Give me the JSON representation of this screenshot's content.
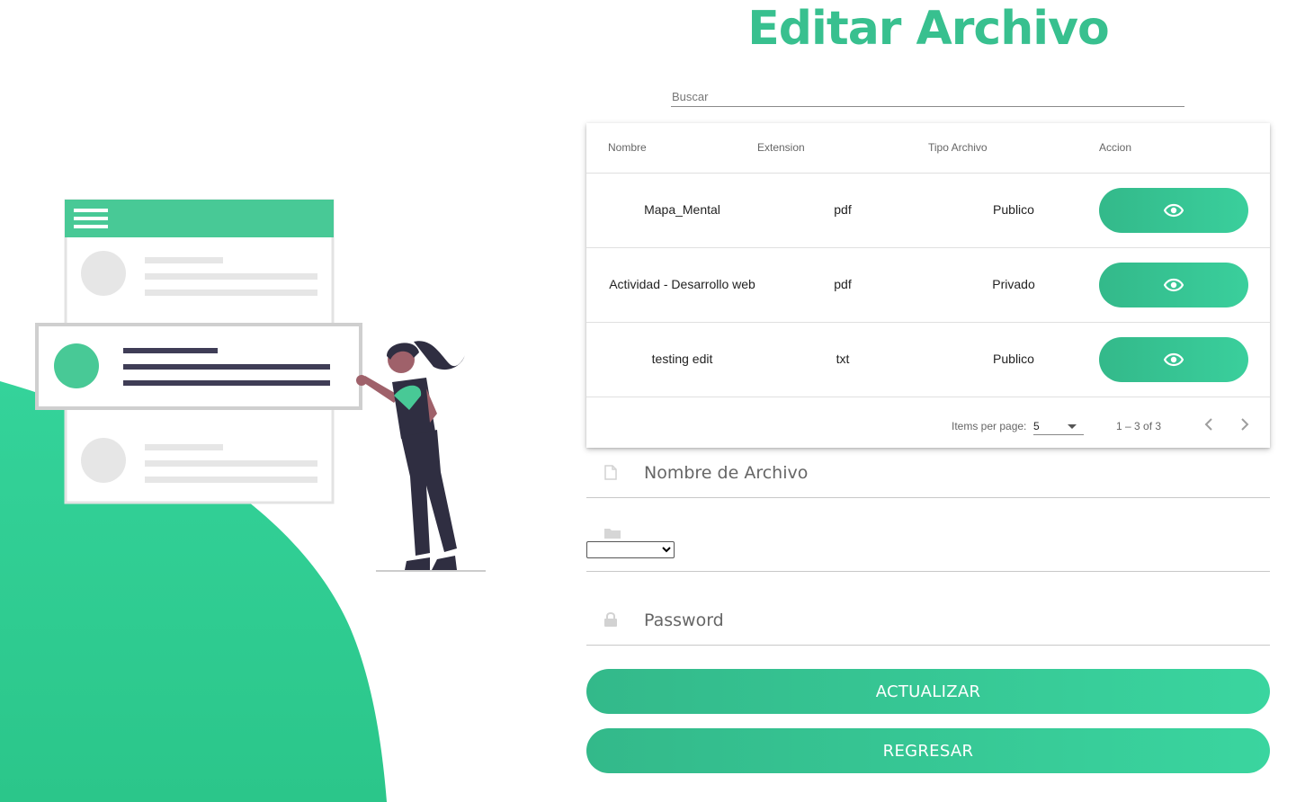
{
  "page": {
    "title": "Editar Archivo"
  },
  "search": {
    "placeholder": "Buscar"
  },
  "table": {
    "columns": [
      "Nombre",
      "Extension",
      "Tipo Archivo",
      "Accion"
    ],
    "rows": [
      {
        "nombre": "Mapa_Mental",
        "extension": "pdf",
        "tipo": "Publico",
        "action_icon": "eye-icon"
      },
      {
        "nombre": "Actividad - Desarrollo web",
        "extension": "pdf",
        "tipo": "Privado",
        "action_icon": "eye-icon"
      },
      {
        "nombre": "testing edit",
        "extension": "txt",
        "tipo": "Publico",
        "action_icon": "eye-icon"
      }
    ],
    "paginator": {
      "items_per_page_label": "Items per page:",
      "items_per_page_value": "5",
      "range_label": "1 – 3 of 3"
    }
  },
  "form": {
    "nombre_placeholder": "Nombre de Archivo",
    "nombre_icon": "file-icon",
    "folder_icon": "folder-icon",
    "folder_select_value": "",
    "password_placeholder": "Password",
    "password_icon": "lock-icon"
  },
  "buttons": {
    "actualizar": "ACTUALIZAR",
    "regresar": "REGRESAR"
  },
  "colors": {
    "accent": "#38c08f",
    "wave": "#2fcf91",
    "figure_dark": "#2f2e41"
  }
}
